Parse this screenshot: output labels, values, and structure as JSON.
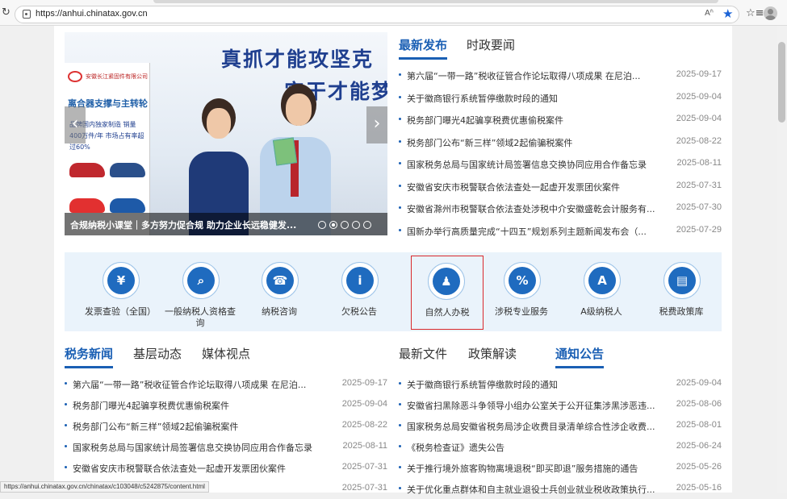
{
  "browser": {
    "url": "https://anhui.chinatax.gov.cn",
    "read_aloud": "Aʱ",
    "status_url": "https://anhui.chinatax.gov.cn/chinatax/c103048/c5242875/content.html"
  },
  "carousel": {
    "slogan_line1": "真抓才能攻坚克",
    "slogan_line2": "实干才能梦",
    "poster_brand": "安徽长江紧固件有限公司",
    "poster_title": "离合器支撑与主转轮",
    "poster_text": "品牌国内独家制造 销量400万件/年 市场占有率超过60%",
    "caption": "合规纳税小课堂｜多方努力促合规 助力企业长远稳健发...",
    "slide_count": 5,
    "active_slide": 2,
    "prev_icon": "‹",
    "next_icon": "›"
  },
  "latest": {
    "tabs": [
      "最新发布",
      "时政要闻"
    ],
    "active": 0,
    "items": [
      {
        "title": "第六届“一带一路”税收征管合作论坛取得八项成果 在尼泊...",
        "date": "2025-09-17"
      },
      {
        "title": "关于徽商银行系统暂停缴款时段的通知",
        "date": "2025-09-04"
      },
      {
        "title": "税务部门曝光4起骗享税费优惠偷税案件",
        "date": "2025-09-04"
      },
      {
        "title": "税务部门公布“新三样”领域2起偷骗税案件",
        "date": "2025-08-22"
      },
      {
        "title": "国家税务总局与国家统计局签署信息交换协同应用合作备忘录",
        "date": "2025-08-11"
      },
      {
        "title": "安徽省安庆市税警联合依法查处一起虚开发票团伙案件",
        "date": "2025-07-31"
      },
      {
        "title": "安徽省滁州市税警联合依法查处涉税中介安徽盛乾会计服务有...",
        "date": "2025-07-30"
      },
      {
        "title": "国新办举行高质量完成“十四五”规划系列主题新闻发布会（...",
        "date": "2025-07-29"
      }
    ]
  },
  "services": [
    {
      "label": "发票查验（全国）",
      "icon": "¥",
      "name": "invoice-check"
    },
    {
      "label": "一般纳税人资格查询",
      "icon": "⌕",
      "name": "general-taxpayer-query"
    },
    {
      "label": "纳税咨询",
      "icon": "☎",
      "name": "tax-consult"
    },
    {
      "label": "欠税公告",
      "icon": "i",
      "name": "tax-arrears-notice"
    },
    {
      "label": "自然人办税",
      "icon": "♟",
      "name": "individual-tax"
    },
    {
      "label": "涉税专业服务",
      "icon": "%",
      "name": "tax-professional-service"
    },
    {
      "label": "A级纳税人",
      "icon": "A",
      "name": "a-grade-taxpayer"
    },
    {
      "label": "税费政策库",
      "icon": "▤",
      "name": "tax-policy-library"
    }
  ],
  "selected_service": 4,
  "news": {
    "tabs": [
      "税务新闻",
      "基层动态",
      "媒体视点"
    ],
    "active": 0,
    "items": [
      {
        "title": "第六届“一带一路”税收征管合作论坛取得八项成果 在尼泊...",
        "date": "2025-09-17"
      },
      {
        "title": "税务部门曝光4起骗享税费优惠偷税案件",
        "date": "2025-09-04"
      },
      {
        "title": "税务部门公布“新三样”领域2起偷骗税案件",
        "date": "2025-08-22"
      },
      {
        "title": "国家税务总局与国家统计局签署信息交换协同应用合作备忘录",
        "date": "2025-08-11"
      },
      {
        "title": "安徽省安庆市税警联合依法查处一起虚开发票团伙案件",
        "date": "2025-07-31"
      },
      {
        "title": "",
        "date": "2025-07-31"
      }
    ]
  },
  "notices": {
    "tabs": [
      "最新文件",
      "政策解读",
      "通知公告"
    ],
    "active": 2,
    "items": [
      {
        "title": "关于徽商银行系统暂停缴款时段的通知",
        "date": "2025-09-04"
      },
      {
        "title": "安徽省扫黑除恶斗争领导小组办公室关于公开征集涉黑涉恶违...",
        "date": "2025-08-06"
      },
      {
        "title": "国家税务总局安徽省税务局涉企收费目录清单综合性涉企收费...",
        "date": "2025-08-01"
      },
      {
        "title": "《税务检查证》遗失公告",
        "date": "2025-06-24"
      },
      {
        "title": "关于推行境外旅客购物离境退税“即买即退”服务措施的通告",
        "date": "2025-05-26"
      },
      {
        "title": "关于优化重点群体和自主就业退役士兵创业就业税收政策执行...",
        "date": "2025-05-16"
      }
    ]
  }
}
